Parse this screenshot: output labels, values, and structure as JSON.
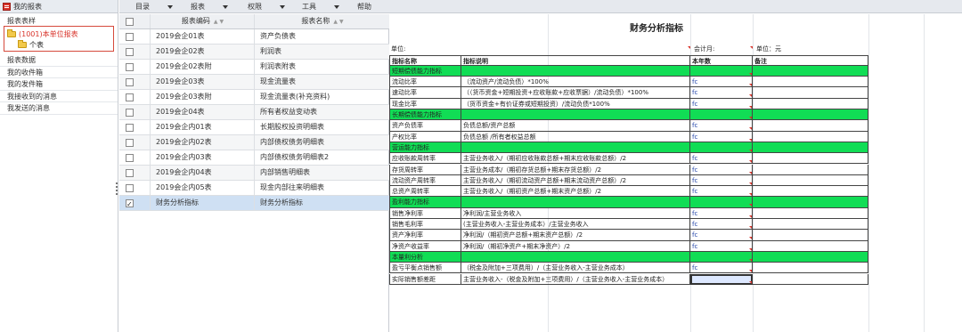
{
  "left_pane": {
    "title": "我的报表",
    "tree_header": "报表表样",
    "tree_root": "(1001)本单位报表",
    "tree_child": "个表",
    "nav_items": [
      "报表数据",
      "我的收件箱",
      "我的发件箱",
      "我接收到的消息",
      "我发送的消息"
    ]
  },
  "menubar": {
    "items": [
      {
        "label": "目录",
        "has_dropdown": true
      },
      {
        "label": "报表",
        "has_dropdown": true
      },
      {
        "label": "权限",
        "has_dropdown": true
      },
      {
        "label": "工具",
        "has_dropdown": true
      },
      {
        "label": "帮助",
        "has_dropdown": false
      }
    ]
  },
  "grid": {
    "columns": [
      "报表编码",
      "报表名称"
    ],
    "rows": [
      {
        "code": "2019会企01表",
        "name": "资产负债表",
        "checked": false
      },
      {
        "code": "2019会企02表",
        "name": "利润表",
        "checked": false
      },
      {
        "code": "2019会企02表附",
        "name": "利润表附表",
        "checked": false
      },
      {
        "code": "2019会企03表",
        "name": "现金流量表",
        "checked": false
      },
      {
        "code": "2019会企03表附",
        "name": "现金流量表(补充资料)",
        "checked": false
      },
      {
        "code": "2019会企04表",
        "name": "所有者权益变动表",
        "checked": false
      },
      {
        "code": "2019会企内01表",
        "name": "长期股权投资明细表",
        "checked": false
      },
      {
        "code": "2019会企内02表",
        "name": "内部债权债务明细表",
        "checked": false
      },
      {
        "code": "2019会企内03表",
        "name": "内部债权债务明细表2",
        "checked": false
      },
      {
        "code": "2019会企内04表",
        "name": "内部销售明细表",
        "checked": false
      },
      {
        "code": "2019会企内05表",
        "name": "现金内部往来明细表",
        "checked": false
      },
      {
        "code": "财务分析指标",
        "name": "财务分析指标",
        "checked": true
      }
    ]
  },
  "sheet": {
    "title": "财务分析指标",
    "meta": {
      "unit_label": "单位:",
      "period_label": "会计月:",
      "currency_label": "单位：元"
    },
    "headers": [
      "指标名称",
      "指标说明",
      "本年数",
      "备注"
    ],
    "rows": [
      {
        "type": "section",
        "name": "短期偿债能力指标"
      },
      {
        "type": "item",
        "name": "流动比率",
        "desc": "（流动资产/流动负债）*100%",
        "value": "fc"
      },
      {
        "type": "item",
        "name": "速动比率",
        "desc": "（（货币资金+短期投资+应收账款+应收票据）/流动负债）*100%",
        "value": "fc"
      },
      {
        "type": "item",
        "name": "现金比率",
        "desc": "（货币资金+有价证券或短期投资）/流动负债*100%",
        "value": "fc"
      },
      {
        "type": "section",
        "name": "长期偿债能力指标"
      },
      {
        "type": "item",
        "name": "资产负债率",
        "desc": "负债总额/资产总额",
        "value": "fc"
      },
      {
        "type": "item",
        "name": "产权比率",
        "desc": "负债总额 /所有者权益总额",
        "value": "fc"
      },
      {
        "type": "section",
        "name": "营运能力指标"
      },
      {
        "type": "item",
        "name": "应收账款周转率",
        "desc": "主营业务收入/（期初应收账款总额+期末应收账款总额）/2",
        "value": "fc"
      },
      {
        "type": "item",
        "name": "存货周转率",
        "desc": "主营业务成本/（期初存货总额+期末存货总额）/2",
        "value": "fc"
      },
      {
        "type": "item",
        "name": "流动资产周转率",
        "desc": "主营业务收入/（期初流动资产总额+期末流动资产总额）/2",
        "value": "fc"
      },
      {
        "type": "item",
        "name": "总资产周转率",
        "desc": "主营业务收入/（期初资产总额+期末资产总额）/2",
        "value": "fc"
      },
      {
        "type": "section",
        "name": "盈利能力指标"
      },
      {
        "type": "item",
        "name": "销售净利率",
        "desc": "净利润/主营业务收入",
        "value": "fc"
      },
      {
        "type": "item",
        "name": "销售毛利率",
        "desc": "(主营业务收入-主营业务成本）/主营业务收入",
        "value": "fc"
      },
      {
        "type": "item",
        "name": "资产净利率",
        "desc": "净利润/（期初资产总额+期末资产总额）/2",
        "value": "fc"
      },
      {
        "type": "item",
        "name": "净资产收益率",
        "desc": "净利润/（期初净资产+期末净资产）/2",
        "value": "fc"
      },
      {
        "type": "section",
        "name": "本量利分析"
      },
      {
        "type": "item",
        "name": "盈亏平衡点销售额",
        "desc": "（税金及附加+三项费用）/（主营业务收入-主营业务成本）",
        "value": "fc"
      },
      {
        "type": "item",
        "name": "实际销售额差距",
        "desc": "主营业务收入-（税金及附加+三项费用）/（主营业务收入-主营业务成本）",
        "value": "",
        "selected": true
      }
    ]
  },
  "colors": {
    "section_fill": "#11dd55",
    "accent_red": "#d8332a",
    "selection": "#cfe0f3"
  }
}
